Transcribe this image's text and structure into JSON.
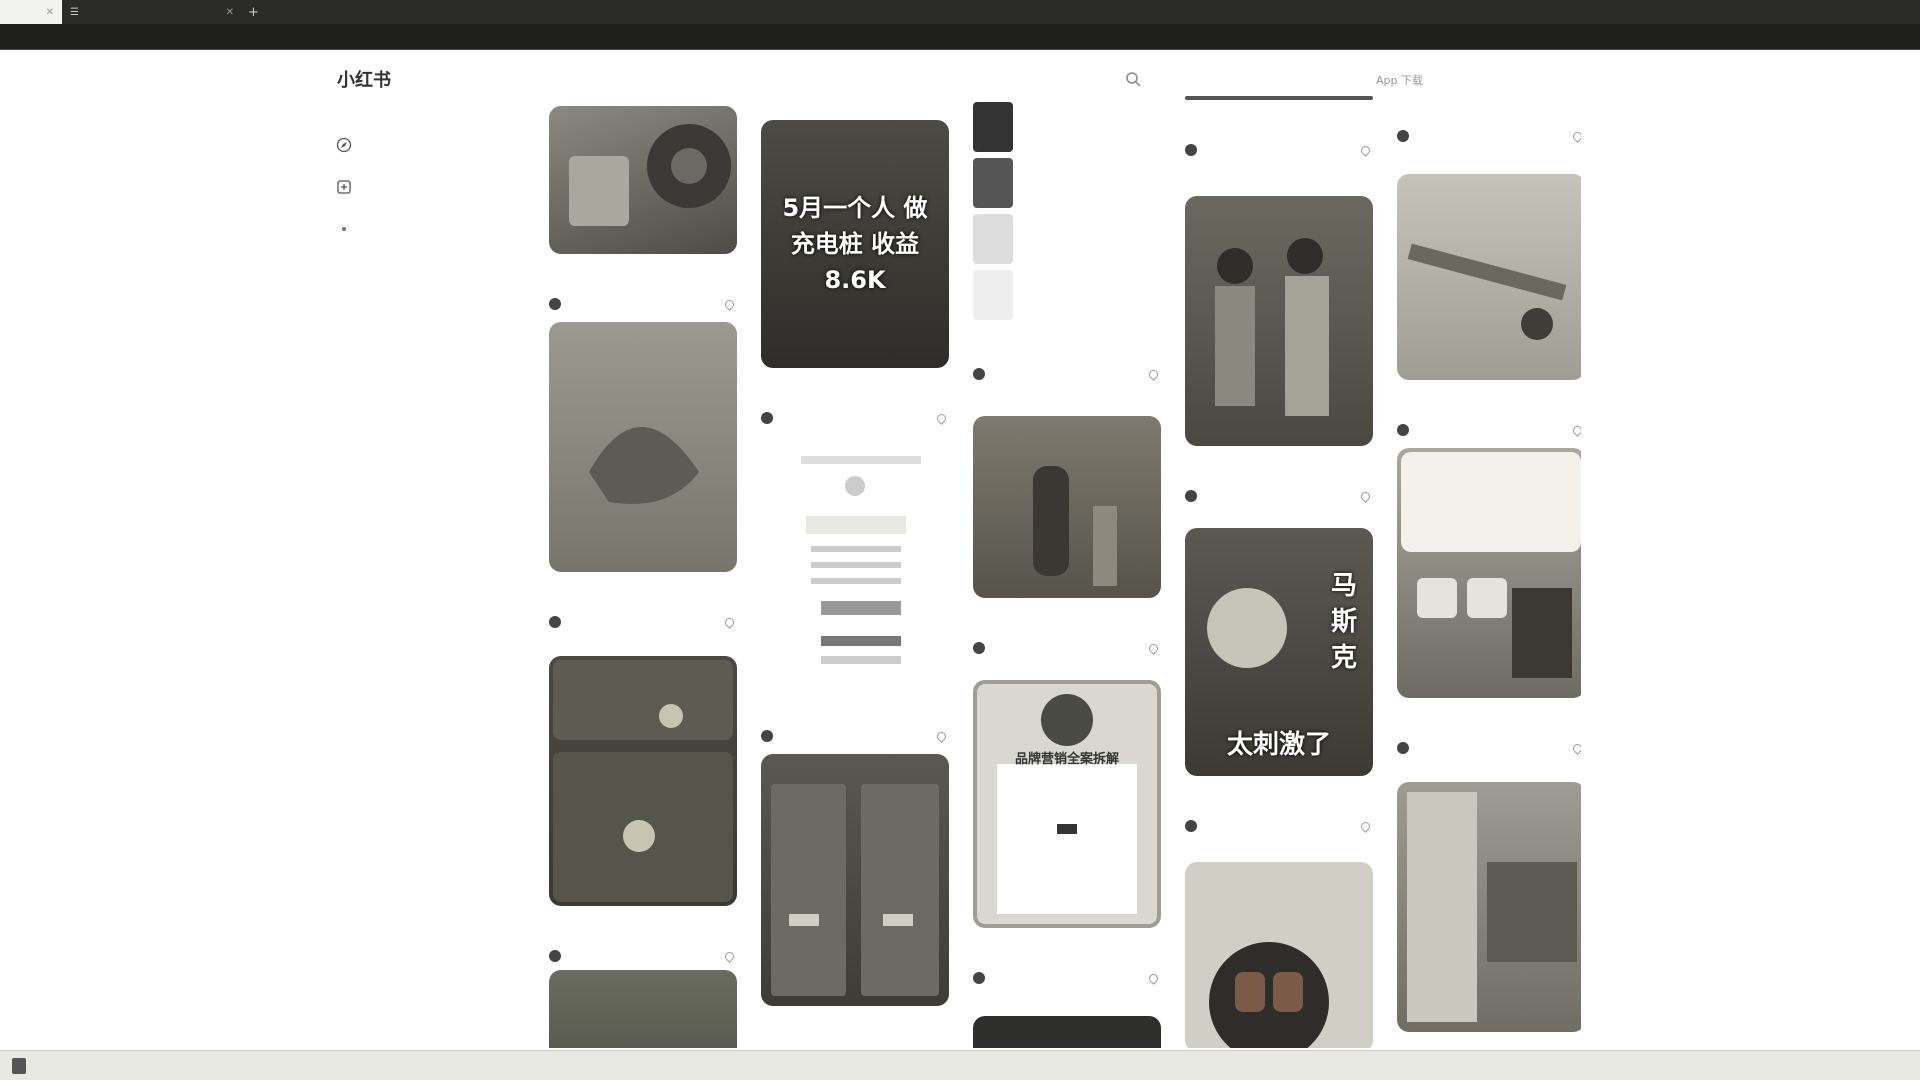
{
  "browser": {
    "tabs": [
      {
        "label": "",
        "active": true
      },
      {
        "label": ""
      }
    ],
    "address": ""
  },
  "site": {
    "logo": "小红书",
    "search_placeholder": "",
    "nav": [
      "",
      "",
      "",
      "App 下载"
    ]
  },
  "sidebar": {
    "items": [
      {
        "label": "",
        "icon": "compass-icon"
      },
      {
        "label": "",
        "icon": "plus-square-icon"
      },
      {
        "label": "",
        "icon": "bell-icon"
      }
    ],
    "footer": [
      "",
      ""
    ]
  },
  "feed": {
    "col1": [
      {
        "caption": "",
        "user": "",
        "likes": "",
        "cover": "#6b6a64"
      },
      {
        "caption": "",
        "overlay": "",
        "user": "",
        "likes": "",
        "cover": "#8a8880"
      },
      {
        "caption": "",
        "user": "",
        "likes": "",
        "cover": "#4a4a42"
      },
      {
        "caption": "",
        "user": "",
        "likes": "",
        "cover": "#57584c"
      }
    ],
    "col2": [
      {
        "caption": "",
        "overlay": "5月一个人 做充电桩 收益8.6K",
        "user": "",
        "likes": "",
        "cover": "#3d3c37"
      },
      {
        "caption": "",
        "user": "",
        "likes": "",
        "cover": "#f4f4f2"
      },
      {
        "caption": "",
        "user": "",
        "likes": "",
        "cover": "#4a4944"
      }
    ],
    "col3": [
      {
        "caption": "",
        "user": "",
        "likes": "",
        "cover": "#ffffff"
      },
      {
        "caption": "",
        "user": "",
        "likes": "",
        "cover": "#6e6a60"
      },
      {
        "caption": "",
        "overlay": "品牌营销全案拆解",
        "user": "",
        "likes": "",
        "cover": "#d9d8d0"
      },
      {
        "caption": "",
        "overlay": "",
        "user": "",
        "likes": "",
        "cover": "#2e2e2c"
      }
    ],
    "col4": [
      {
        "caption": "",
        "user": "",
        "likes": "",
        "cover": "#ffffff"
      },
      {
        "caption": "",
        "user": "",
        "likes": "",
        "cover": "#5c5a52"
      },
      {
        "caption": "",
        "overlay": "太刺激了",
        "side_text": "马斯克",
        "user": "",
        "likes": "",
        "cover": "#4d4c46"
      },
      {
        "caption": "",
        "user": "",
        "likes": "",
        "cover": "#cfcfc6"
      }
    ],
    "col5": [
      {
        "caption": "",
        "user": "",
        "likes": "",
        "cover": "#ffffff"
      },
      {
        "caption": "",
        "user": "",
        "likes": "",
        "cover": "#b8b7ae"
      },
      {
        "caption": "",
        "user": "",
        "likes": "",
        "cover": "#9a9990"
      },
      {
        "caption": "",
        "user": "",
        "likes": "",
        "cover": "#8d8c84"
      }
    ],
    "phone_list": [
      "",
      "",
      "",
      ""
    ]
  }
}
